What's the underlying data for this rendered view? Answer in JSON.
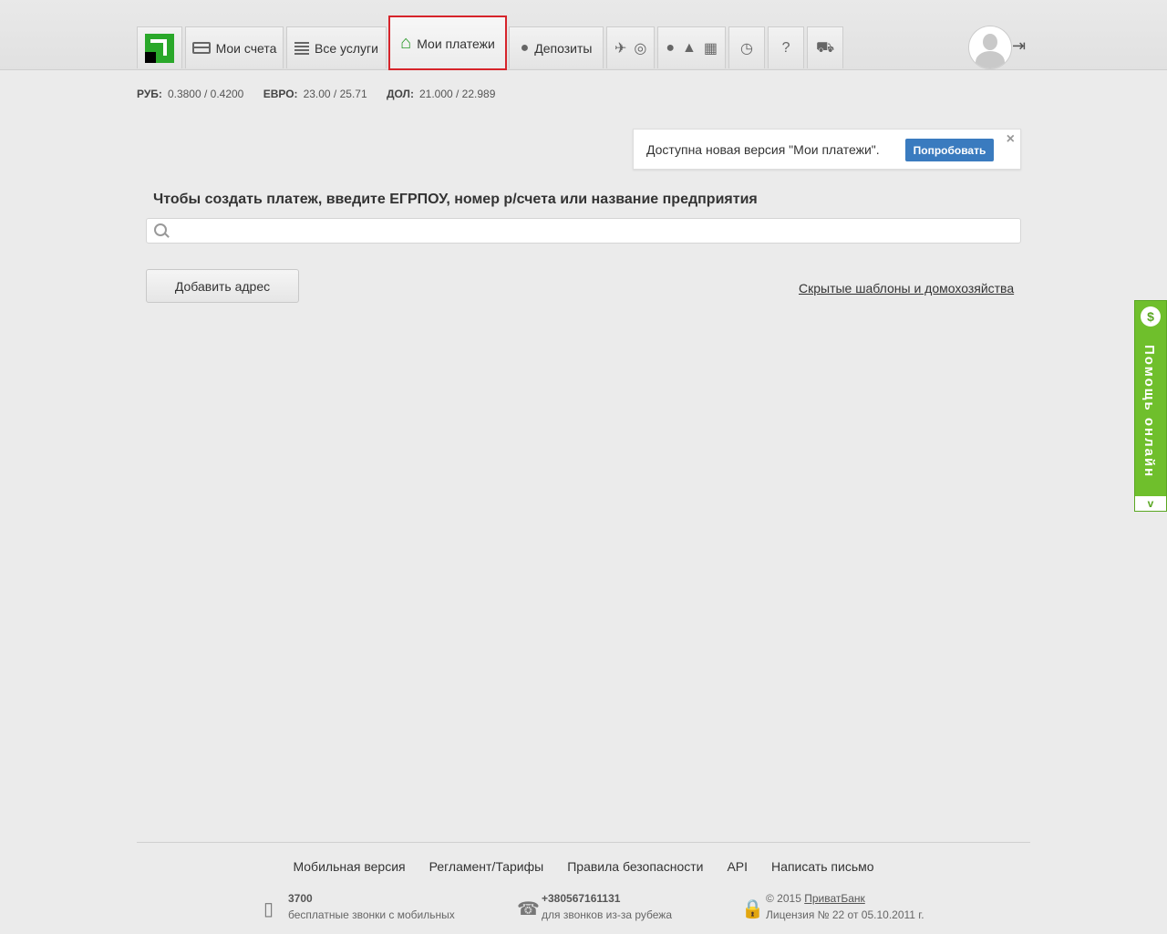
{
  "nav": {
    "accounts": "Мои счета",
    "services": "Все услуги",
    "payments": "Мои платежи",
    "deposits": "Депозиты"
  },
  "rates": {
    "rub_label": "РУБ:",
    "rub_value": "0.3800 / 0.4200",
    "eur_label": "ЕВРО:",
    "eur_value": "23.00 / 25.71",
    "usd_label": "ДОЛ:",
    "usd_value": "21.000 / 22.989"
  },
  "promo": {
    "text": "Доступна новая версия \"Мои платежи\".",
    "button": "Попробовать",
    "close": "×"
  },
  "main": {
    "prompt": "Чтобы создать платеж, введите ЕГРПОУ, номер р/счета или название предприятия",
    "search_value": "",
    "add_address": "Добавить адрес",
    "hidden_link": "Скрытые шаблоны и домохозяйства"
  },
  "help": {
    "label": "Помощь онлайн",
    "badge": "$",
    "arrow": "v"
  },
  "footer": {
    "links": [
      "Мобильная версия",
      "Регламент/Тарифы",
      "Правила безопасности",
      "API",
      "Написать письмо"
    ],
    "phone1": "3700",
    "phone1_desc": "бесплатные звонки с мобильных",
    "phone2": "+380567161131",
    "phone2_desc": "для звонков из-за рубежа",
    "copyright": "© 2015",
    "bank": "ПриватБанк",
    "license": "Лицензия № 22 от 05.10.2011 г."
  },
  "colors": {
    "accent_green": "#2aa82a",
    "active_outline": "#d6242b",
    "button_blue": "#3a7bbf"
  }
}
